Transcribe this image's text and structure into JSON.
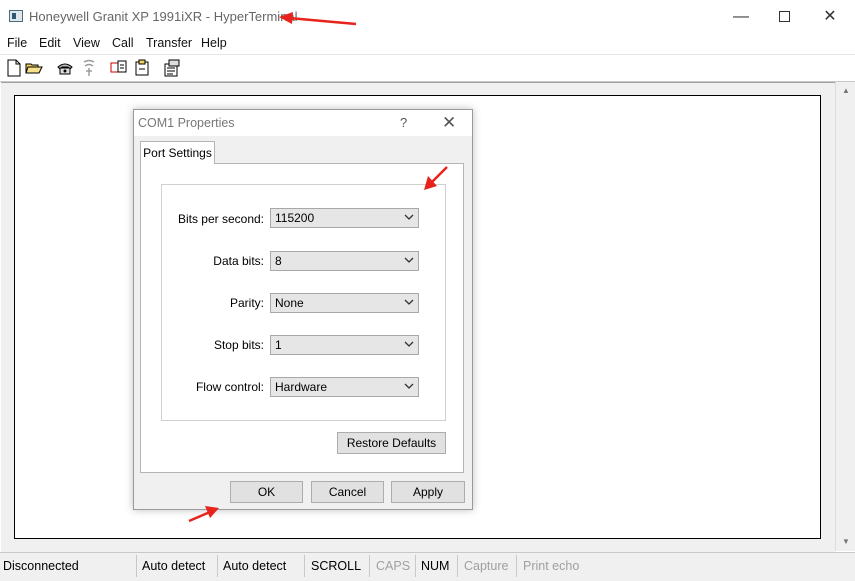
{
  "window": {
    "title": "Honeywell Granit XP 1991iXR - HyperTerminal",
    "minimize_glyph": "—",
    "close_glyph": "✕"
  },
  "menu": [
    "File",
    "Edit",
    "View",
    "Call",
    "Transfer",
    "Help"
  ],
  "toolbar_icons": [
    "new-file-icon",
    "open-folder-icon",
    "call-icon",
    "disconnect-icon",
    "send-icon",
    "receive-icon",
    "properties-icon"
  ],
  "dialog": {
    "title": "COM1 Properties",
    "help_glyph": "?",
    "close_glyph": "✕",
    "tab": "Port Settings",
    "fields": [
      {
        "label": "Bits per second:",
        "value": "115200"
      },
      {
        "label": "Data bits:",
        "value": "8"
      },
      {
        "label": "Parity:",
        "value": "None"
      },
      {
        "label": "Stop bits:",
        "value": "1"
      },
      {
        "label": "Flow control:",
        "value": "Hardware"
      }
    ],
    "restore_defaults": "Restore Defaults",
    "ok": "OK",
    "cancel": "Cancel",
    "apply": "Apply"
  },
  "status": [
    {
      "text": "Disconnected",
      "dim": false
    },
    {
      "text": "Auto detect",
      "dim": false
    },
    {
      "text": "Auto detect",
      "dim": false
    },
    {
      "text": "SCROLL",
      "dim": false
    },
    {
      "text": "CAPS",
      "dim": true
    },
    {
      "text": "NUM",
      "dim": false
    },
    {
      "text": "Capture",
      "dim": true
    },
    {
      "text": "Print echo",
      "dim": true
    }
  ],
  "colors": {
    "annotation": "#e8231c",
    "dim_text": "#a0a0a0"
  }
}
